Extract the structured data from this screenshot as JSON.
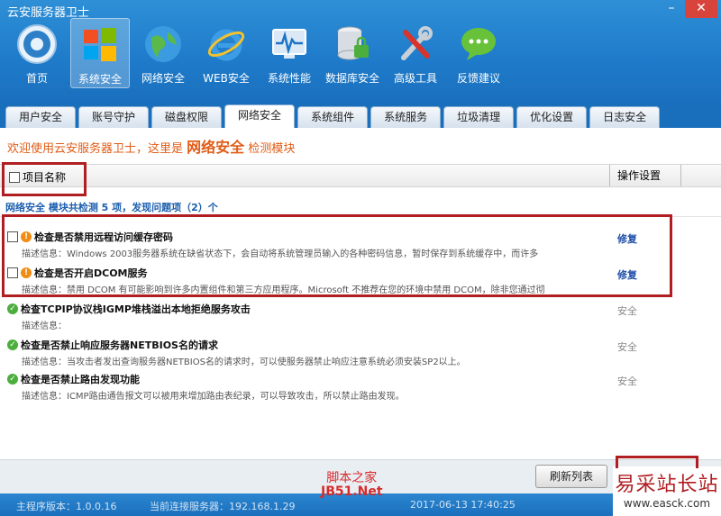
{
  "window": {
    "title": "云安服务器卫士"
  },
  "toolbar": [
    {
      "label": "首页",
      "icon": "home-icon"
    },
    {
      "label": "系统安全",
      "icon": "windows-logo-icon",
      "active": true
    },
    {
      "label": "网络安全",
      "icon": "globe-icon"
    },
    {
      "label": "WEB安全",
      "icon": "ie-icon"
    },
    {
      "label": "系统性能",
      "icon": "monitor-icon"
    },
    {
      "label": "数据库安全",
      "icon": "database-lock-icon"
    },
    {
      "label": "高级工具",
      "icon": "tools-icon"
    },
    {
      "label": "反馈建议",
      "icon": "chat-bubble-icon"
    }
  ],
  "tabs": [
    {
      "label": "用户安全"
    },
    {
      "label": "账号守护"
    },
    {
      "label": "磁盘权限"
    },
    {
      "label": "网络安全",
      "active": true
    },
    {
      "label": "系统组件"
    },
    {
      "label": "系统服务"
    },
    {
      "label": "垃圾清理"
    },
    {
      "label": "优化设置"
    },
    {
      "label": "日志安全"
    }
  ],
  "welcome": {
    "prefix": "欢迎使用云安服务器卫士，这里是",
    "module": "网络安全",
    "suffix": "检测模块"
  },
  "list_header": {
    "name": "项目名称",
    "operation": "操作设置"
  },
  "summary": "网络安全 模块共检测 5 项，发现问题项（2）个",
  "items": [
    {
      "title": "检查是否禁用远程访问缓存密码",
      "desc": "描述信息：Windows 2003服务器系统在缺省状态下，会自动将系统管理员输入的各种密码信息，暂时保存到系统缓存中，而许多",
      "status": "warn",
      "op": "修复"
    },
    {
      "title": "检查是否开启DCOM服务",
      "desc": "描述信息：禁用 DCOM 有可能影响到许多内置组件和第三方应用程序。Microsoft 不推荐在您的环境中禁用 DCOM，除非您通过彻",
      "status": "warn",
      "op": "修复"
    },
    {
      "title": "检查TCPIP协议栈IGMP堆栈溢出本地拒绝服务攻击",
      "desc": "描述信息：",
      "status": "ok",
      "op": "安全"
    },
    {
      "title": "检查是否禁止响应服务器NETBIOS名的请求",
      "desc": "描述信息：当攻击者发出查询服务器NETBIOS名的请求时，可以使服务器禁止响应注意系统必须安装SP2以上。",
      "status": "ok",
      "op": "安全"
    },
    {
      "title": "检查是否禁止路由发现功能",
      "desc": "描述信息：ICMP路由通告报文可以被用来增加路由表纪录，可以导致攻击，所以禁止路由发现。",
      "status": "ok",
      "op": "安全"
    }
  ],
  "actions": {
    "refresh_label": "刷新列表"
  },
  "statusbar": {
    "version": "主程序版本：1.0.0.16",
    "server": "当前连接服务器：192.168.1.29",
    "time": "2017-06-13 17:40:25"
  },
  "watermarks": {
    "jb51_line1": "脚本之家",
    "jb51_line2": "JB51.Net",
    "easck_line1": "易采站长站",
    "easck_line2": "www.easck.com"
  }
}
